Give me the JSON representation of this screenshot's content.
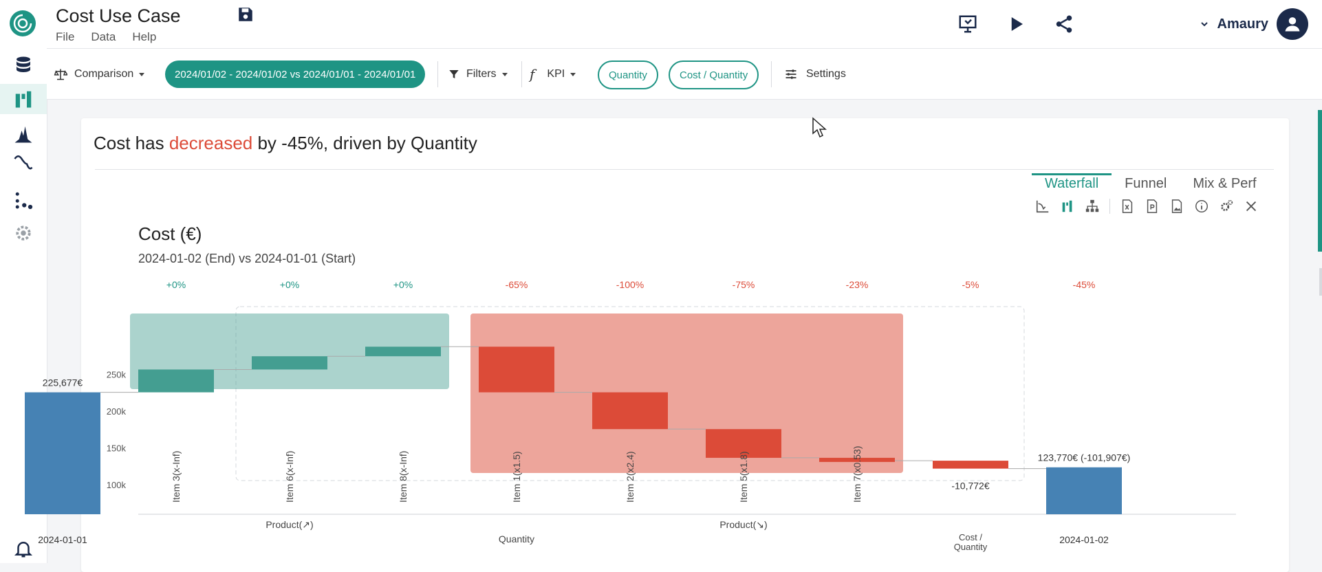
{
  "app": {
    "title": "Cost Use Case",
    "menu": [
      "File",
      "Data",
      "Help"
    ]
  },
  "user": {
    "name": "Amaury"
  },
  "toolbar": {
    "comparison_label": "Comparison",
    "date_range": "2024/01/02 - 2024/01/02 vs 2024/01/01 - 2024/01/01",
    "filters_label": "Filters",
    "kpi_label": "KPI",
    "kpi_pills": [
      "Quantity",
      "Cost / Quantity"
    ],
    "settings_label": "Settings"
  },
  "insight": {
    "prefix": "Cost has ",
    "highlight": "decreased",
    "suffix": " by -45%, driven by Quantity"
  },
  "tabs": [
    "Waterfall",
    "Funnel",
    "Mix & Perf"
  ],
  "colors": {
    "accent": "#1e9484",
    "positive": "#449e91",
    "negative": "#dc4b38",
    "total": "#4682b4"
  },
  "icons": {
    "topbar": [
      "presentation-icon",
      "play-icon",
      "share-icon"
    ],
    "sidebar": [
      "database-icon",
      "waterfall-icon",
      "distribution-icon",
      "trend-icon",
      "scatter-icon",
      "gear-settings-icon",
      "bell-icon"
    ],
    "chart_tools": [
      "curve-icon",
      "waterfall-view-icon",
      "hierarchy-icon",
      "excel-export-icon",
      "pdf-export-icon",
      "image-export-icon",
      "info-icon",
      "settings-icon",
      "close-icon"
    ]
  },
  "chart_data": {
    "type": "waterfall",
    "title": "Cost (€)",
    "subtitle": "2024-01-02 (End) vs 2024-01-01 (Start)",
    "ylim": [
      60000,
      310000
    ],
    "yticks": [
      100000,
      150000,
      200000,
      250000
    ],
    "ytick_labels": [
      "100k",
      "150k",
      "200k",
      "250k"
    ],
    "start": {
      "label": "2024-01-01",
      "value": 225677,
      "value_label": "225,677€",
      "pct": ""
    },
    "end": {
      "label": "2024-01-02",
      "value": 123770,
      "value_label": "123,770€ (-101,907€)",
      "pct": "-45%"
    },
    "steps": [
      {
        "label": "Item 3(x-Inf)",
        "delta": 31000,
        "pct": "+0%",
        "group": "Product(↗)"
      },
      {
        "label": "Item 6(x-Inf)",
        "delta": 18000,
        "pct": "+0%",
        "group": "Product(↗)"
      },
      {
        "label": "Item 8(x-Inf)",
        "delta": 13000,
        "pct": "+0%",
        "group": "Product(↗)"
      },
      {
        "label": "Item 1(x1.5)",
        "delta": -62000,
        "pct": "-65%",
        "group": "Product(↘)"
      },
      {
        "label": "Item 2(x2.4)",
        "delta": -50000,
        "pct": "-100%",
        "group": "Product(↘)"
      },
      {
        "label": "Item 5(x1.8)",
        "delta": -39000,
        "pct": "-75%",
        "group": "Product(↘)"
      },
      {
        "label": "Item 7(x0.53)",
        "delta": -3900,
        "pct": "-23%",
        "group": "Product(↘)"
      },
      {
        "label": "",
        "delta": -10772,
        "value_label": "-10,772€",
        "pct": "-5%",
        "group": "Cost / Quantity"
      }
    ],
    "group_labels": [
      {
        "text": "Product(↗)"
      },
      {
        "text": "Quantity"
      },
      {
        "text": "Product(↘)"
      },
      {
        "text": "Cost / Quantity"
      }
    ]
  }
}
